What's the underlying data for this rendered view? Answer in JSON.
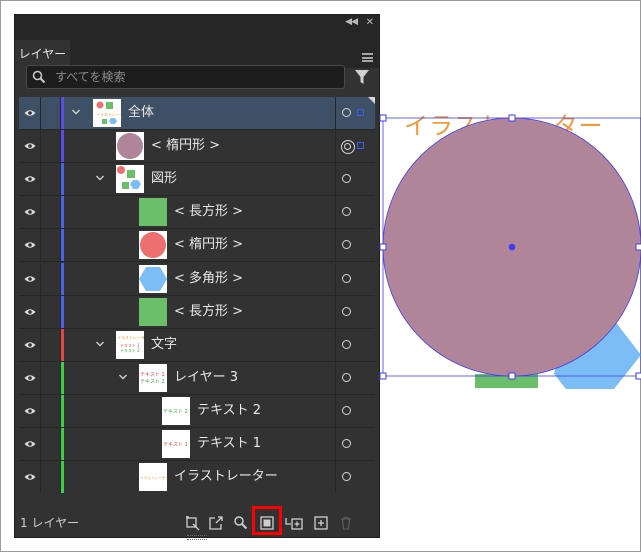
{
  "panel": {
    "tab_label": "レイヤー",
    "collapse_icon": "double-chevron-left-icon",
    "close_icon": "close-icon",
    "menu_icon": "hamburger-menu-icon",
    "search": {
      "placeholder": "すべてを検索",
      "value": ""
    },
    "filter_icon": "filter-funnel-icon"
  },
  "layers": [
    {
      "label": "全体",
      "indent_level": 0,
      "expanded": true,
      "selected": true,
      "color": "#5a4ee6",
      "target": "single",
      "selection_color": "#3d5cf5"
    },
    {
      "label": "< 楕円形 >",
      "indent_level": 1,
      "expanded": null,
      "selected": false,
      "color": "#5a4ee6",
      "target": "double",
      "selection_color": "#3d5cf5"
    },
    {
      "label": "図形",
      "indent_level": 1,
      "expanded": true,
      "selected": false,
      "color": "#4a64e8",
      "target": "single"
    },
    {
      "label": "< 長方形 >",
      "indent_level": 2,
      "expanded": null,
      "selected": false,
      "color": "#4a64e8",
      "target": "single"
    },
    {
      "label": "< 楕円形 >",
      "indent_level": 2,
      "expanded": null,
      "selected": false,
      "color": "#4a64e8",
      "target": "single"
    },
    {
      "label": "< 多角形 >",
      "indent_level": 2,
      "expanded": null,
      "selected": false,
      "color": "#4a64e8",
      "target": "single"
    },
    {
      "label": "< 長方形 >",
      "indent_level": 2,
      "expanded": null,
      "selected": false,
      "color": "#4a64e8",
      "target": "single"
    },
    {
      "label": "文字",
      "indent_level": 1,
      "expanded": true,
      "selected": false,
      "color": "#e04848",
      "target": "single"
    },
    {
      "label": "レイヤー 3",
      "indent_level": 2,
      "expanded": true,
      "selected": false,
      "color": "#3ccf4e",
      "target": "single"
    },
    {
      "label": "テキスト 2",
      "indent_level": 3,
      "expanded": null,
      "selected": false,
      "color": "#3ccf4e",
      "target": "single"
    },
    {
      "label": "テキスト 1",
      "indent_level": 3,
      "expanded": null,
      "selected": false,
      "color": "#3ccf4e",
      "target": "single"
    },
    {
      "label": "イラストレーター",
      "indent_level": 2,
      "expanded": null,
      "selected": false,
      "color": "#3ccf4e",
      "target": "single"
    }
  ],
  "thumb_text": {
    "mini_title": "イラストレーター",
    "text1": "テキスト 1",
    "text2": "テキスト 2"
  },
  "bottom": {
    "layer_count": "1 レイヤー",
    "tools": [
      "artboard-collect-icon",
      "export-icon",
      "locate-object-icon",
      "make-clipping-mask-icon",
      "new-sublayer-icon",
      "new-layer-icon",
      "delete-layer-icon"
    ],
    "highlighted_tool": "make-clipping-mask-icon"
  },
  "artboard": {
    "title_text": "イラストレーター",
    "title_color": "#f29a3c",
    "circle_color": "#b08599",
    "hexagon_color": "#7bbdf4",
    "rect_color": "#6cbf6a",
    "selection_color": "#3d3df0"
  }
}
